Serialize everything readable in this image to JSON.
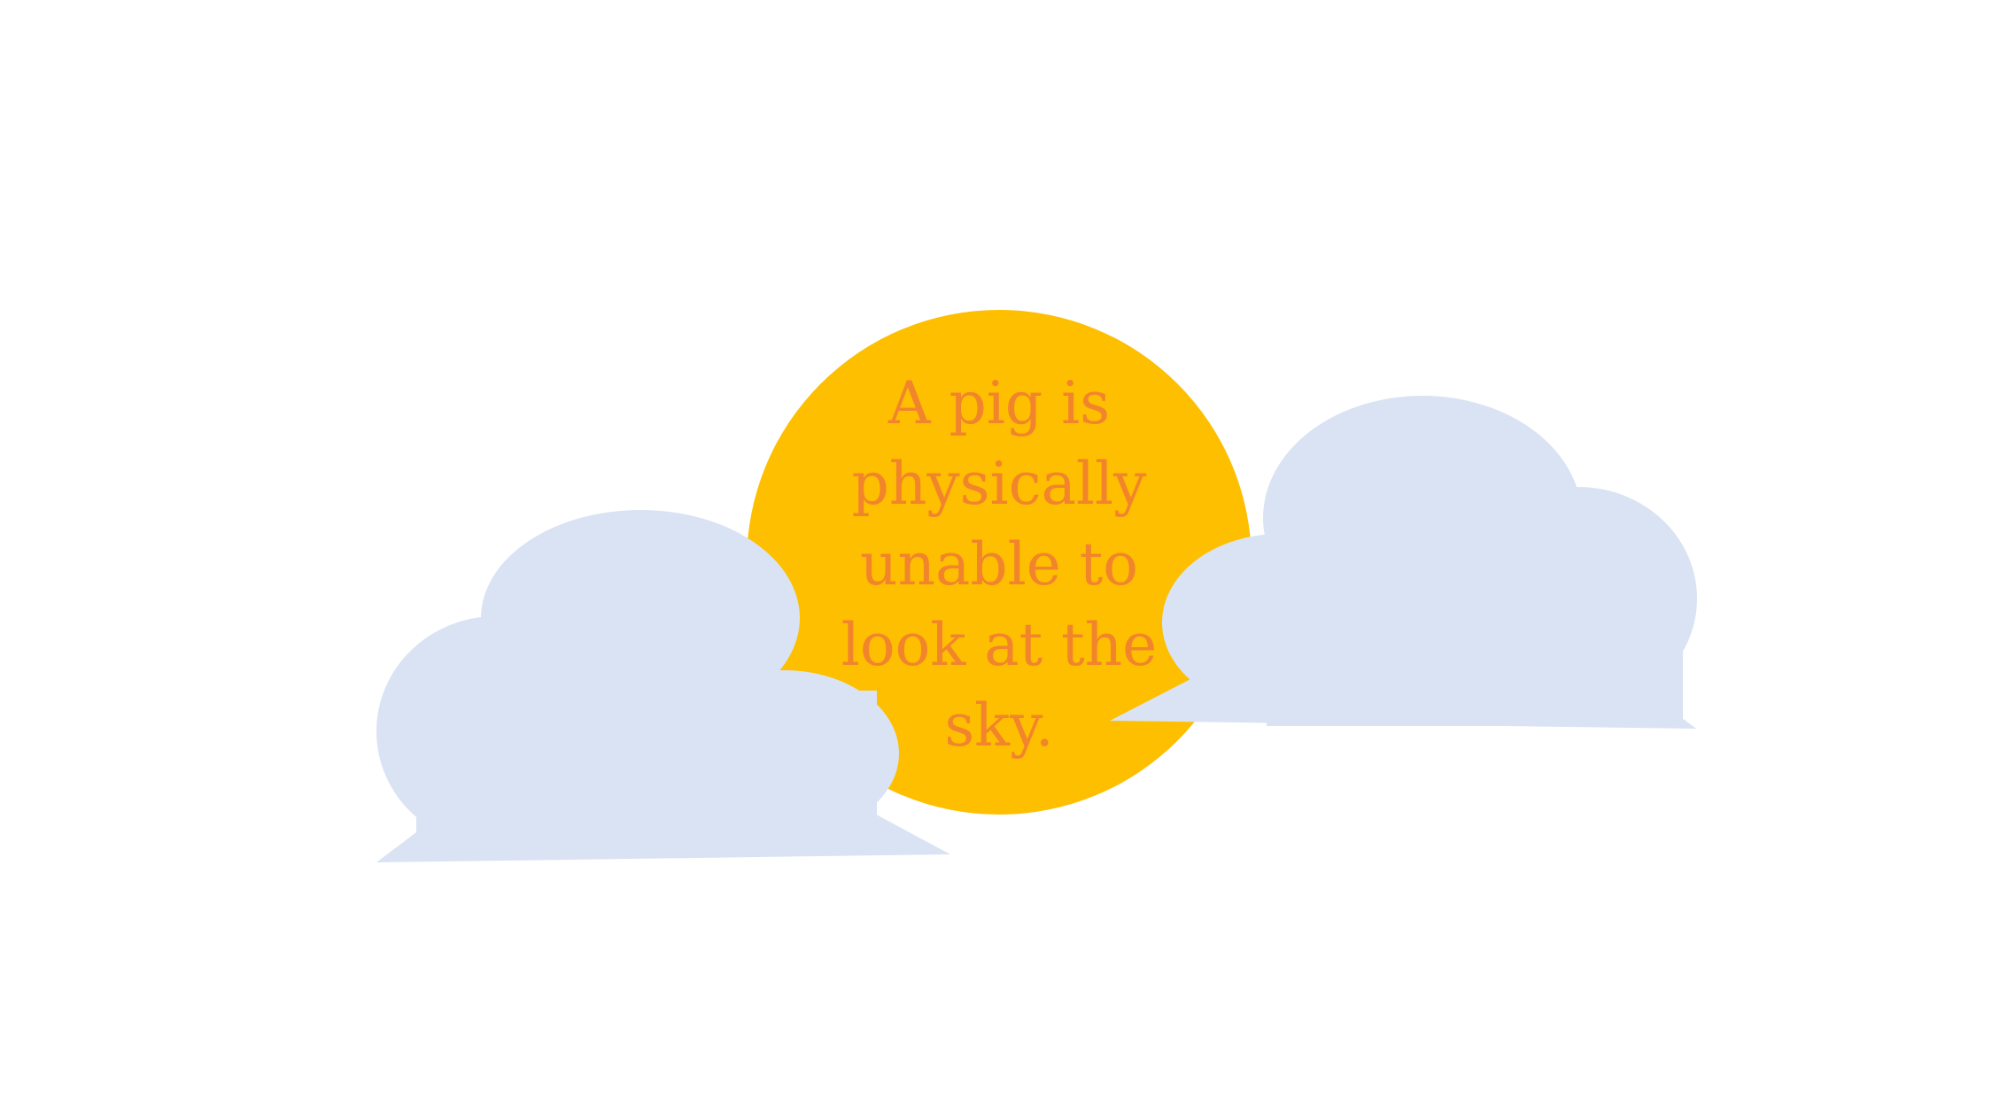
{
  "fact": {
    "text": "A pig is physically unable to look at the sky."
  },
  "colors": {
    "background": "#ffffff",
    "sun": "#fdbf00",
    "text": "#f2842c",
    "cloud": "#dae3f3"
  },
  "icons": {
    "sun": "sun-icon",
    "cloud_left": "cloud-icon",
    "cloud_right": "cloud-icon"
  }
}
